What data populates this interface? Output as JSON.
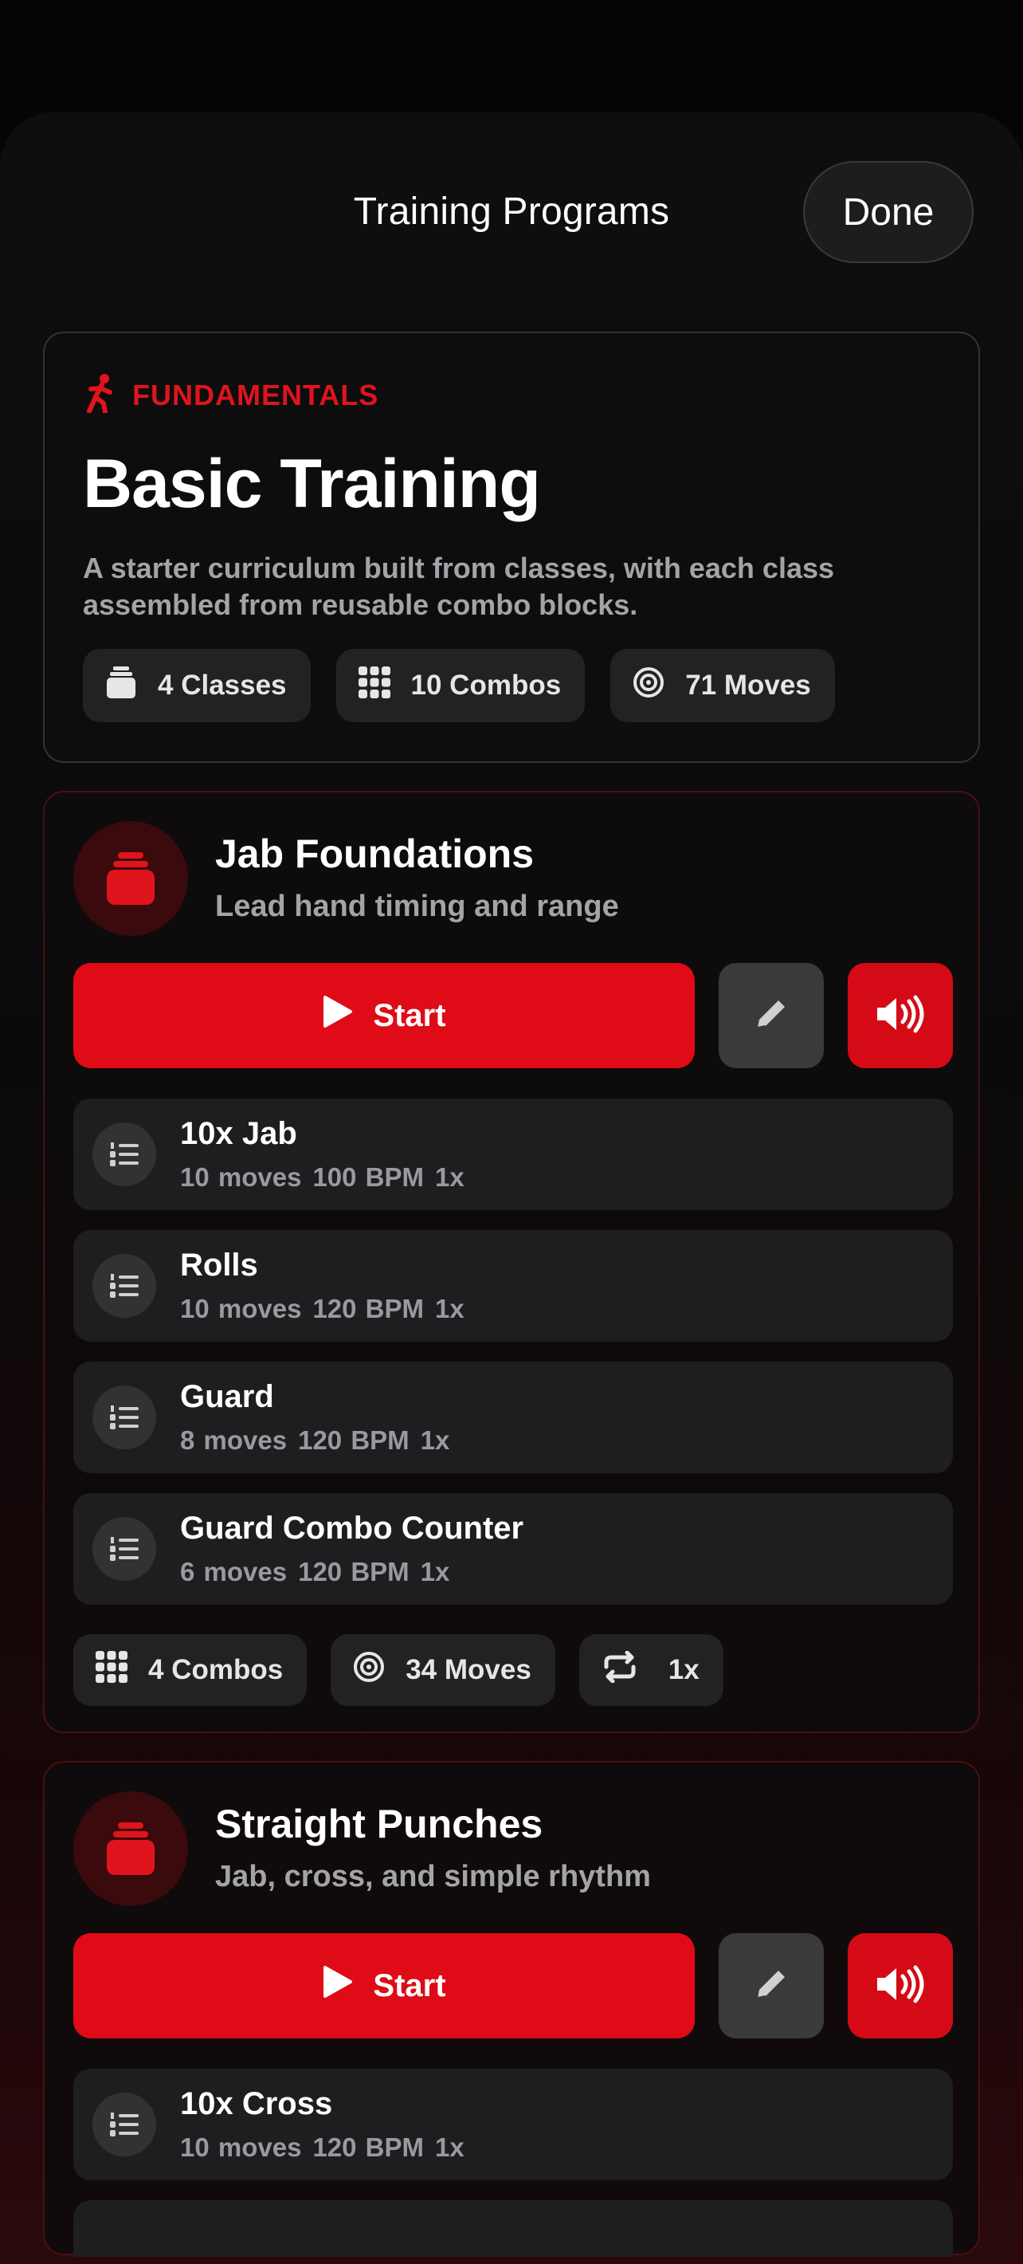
{
  "header": {
    "title": "Training Programs",
    "done_label": "Done"
  },
  "program": {
    "level": "FUNDAMENTALS",
    "title": "Basic Training",
    "description": "A starter curriculum built from classes, with each class assembled from reusable combo blocks.",
    "stats": {
      "classes": "4 Classes",
      "combos": "10 Combos",
      "moves": "71 Moves"
    }
  },
  "classes": [
    {
      "name": "Jab Foundations",
      "subtitle": "Lead hand timing and range",
      "start_label": "Start",
      "combos": [
        {
          "name": "10x Jab",
          "moves": "10 moves",
          "bpm": "100 BPM",
          "reps": "1x"
        },
        {
          "name": "Rolls",
          "moves": "10 moves",
          "bpm": "120 BPM",
          "reps": "1x"
        },
        {
          "name": "Guard",
          "moves": "8 moves",
          "bpm": "120 BPM",
          "reps": "1x"
        },
        {
          "name": "Guard Combo Counter",
          "moves": "6 moves",
          "bpm": "120 BPM",
          "reps": "1x"
        }
      ],
      "summary": {
        "combos": "4 Combos",
        "moves": "34 Moves",
        "repeat": "1x"
      }
    },
    {
      "name": "Straight Punches",
      "subtitle": "Jab, cross, and simple rhythm",
      "start_label": "Start",
      "combos": [
        {
          "name": "10x Cross",
          "moves": "10 moves",
          "bpm": "120 BPM",
          "reps": "1x"
        }
      ]
    }
  ],
  "colors": {
    "accent": "#df0b16",
    "background": "#0d0d0e",
    "chip": "#222224"
  }
}
